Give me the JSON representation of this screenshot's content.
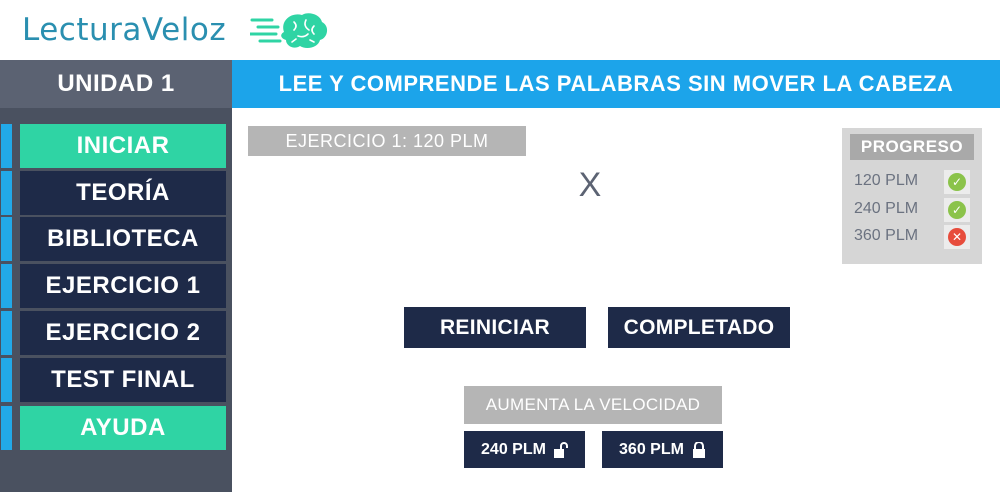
{
  "header": {
    "logo_text": "LecturaVeloz",
    "logo_icon": "brain-speed-icon"
  },
  "sidebar": {
    "unit_title": "UNIDAD 1",
    "items": [
      {
        "label": "INICIAR",
        "active": true
      },
      {
        "label": "TEORÍA",
        "active": false
      },
      {
        "label": "BIBLIOTECA",
        "active": false
      },
      {
        "label": "EJERCICIO 1",
        "active": false
      },
      {
        "label": "EJERCICIO 2",
        "active": false
      },
      {
        "label": "TEST FINAL",
        "active": false
      },
      {
        "label": "AYUDA",
        "active": true
      }
    ]
  },
  "banner": {
    "title": "LEE Y COMPRENDE LAS PALABRAS SIN MOVER LA CABEZA"
  },
  "exercise": {
    "label": "EJERCICIO 1: 120 PLM",
    "current_word": "X"
  },
  "progress": {
    "title": "PROGRESO",
    "rows": [
      {
        "label": "120 PLM",
        "status": "check-icon"
      },
      {
        "label": "240 PLM",
        "status": "check-icon"
      },
      {
        "label": "360 PLM",
        "status": "cross-icon"
      }
    ]
  },
  "actions": {
    "restart_label": "REINICIAR",
    "completed_label": "COMPLETADO"
  },
  "speed": {
    "label": "AUMENTA LA VELOCIDAD",
    "options": [
      {
        "label": "240 PLM",
        "icon": "unlocked-icon"
      },
      {
        "label": "360 PLM",
        "icon": "locked-icon"
      }
    ]
  },
  "colors": {
    "accent_blue": "#1ca4ea",
    "accent_green": "#2fd4a4",
    "navy": "#1e2a48",
    "sidebar_bg": "#4a5160"
  }
}
